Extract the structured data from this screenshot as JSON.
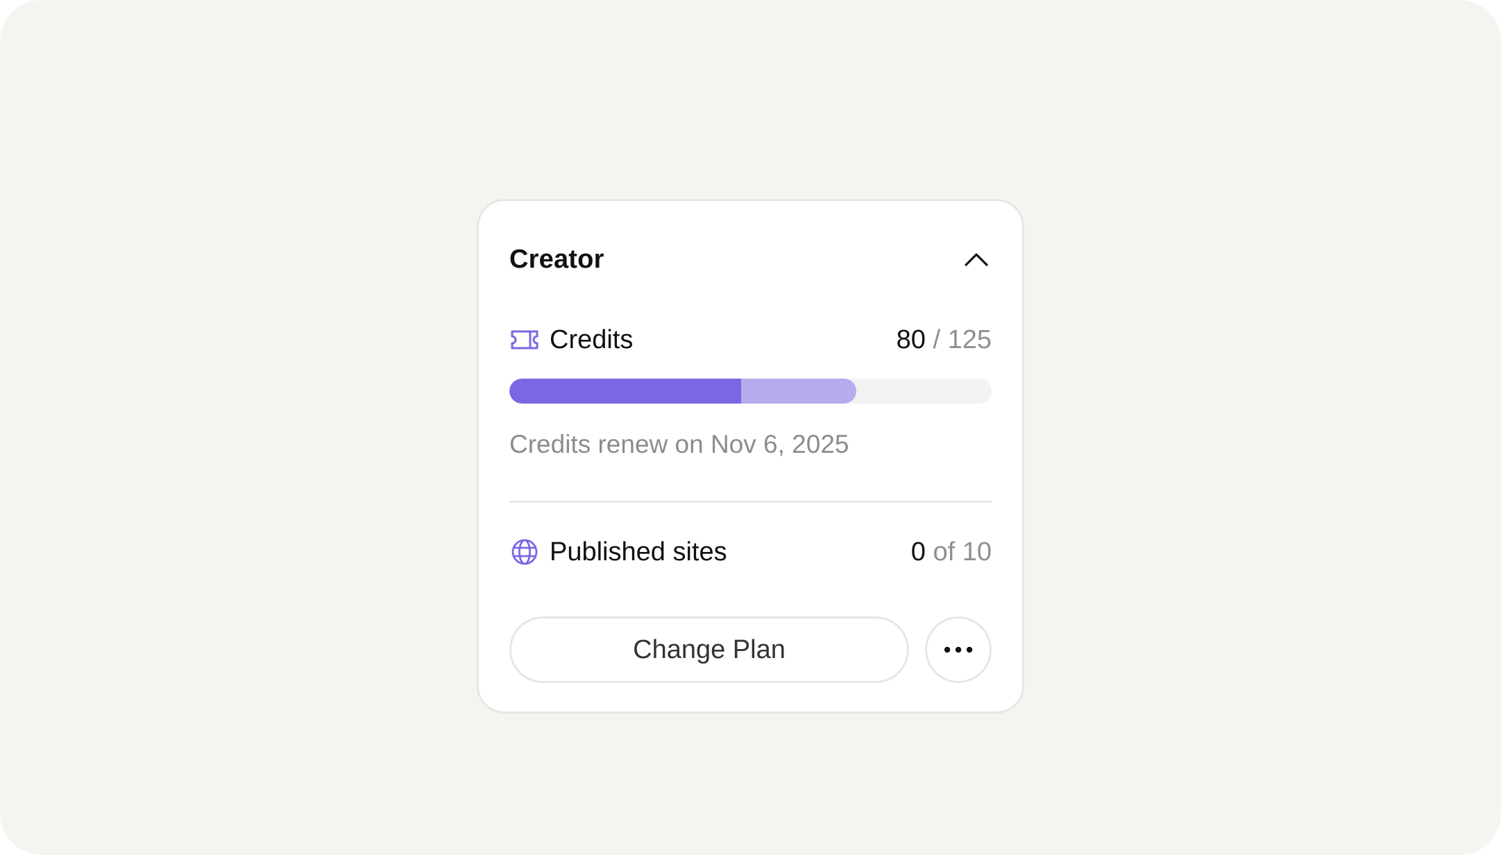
{
  "plan": {
    "title": "Creator",
    "collapse_icon": "chevron-up-icon"
  },
  "credits": {
    "icon": "ticket-icon",
    "label": "Credits",
    "used": "80",
    "separator_total": " / 125",
    "used_value": 80,
    "total_value": 125,
    "renew_text": "Credits renew on Nov 6, 2025",
    "progress_used_fraction": 0.48,
    "progress_extra_fraction": 0.24
  },
  "published_sites": {
    "icon": "globe-icon",
    "label": "Published sites",
    "count": "0",
    "of_total": " of 10"
  },
  "actions": {
    "change_plan_label": "Change Plan",
    "more_icon": "more-horizontal-icon"
  },
  "colors": {
    "accent": "#7b66e3",
    "accent_light": "#b6abec",
    "track": "#f2f2f2",
    "background": "#f5f4f0"
  }
}
